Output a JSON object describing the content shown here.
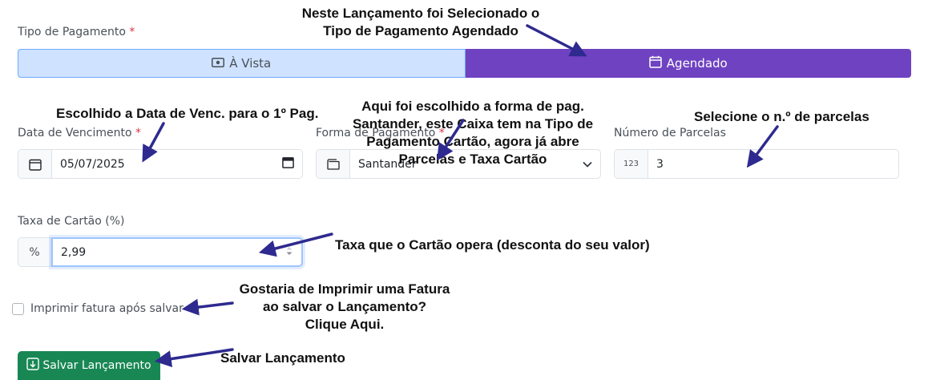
{
  "payment_type": {
    "label": "Tipo de Pagamento",
    "required_mark": "*",
    "options": [
      {
        "label": "À Vista",
        "icon": "cash-icon",
        "selected": false
      },
      {
        "label": "Agendado",
        "icon": "calendar-icon",
        "selected": true
      }
    ]
  },
  "due_date": {
    "label": "Data de Vencimento",
    "required_mark": "*",
    "value": "05/07/2025",
    "icon": "calendar-icon"
  },
  "payment_method": {
    "label": "Forma de Pagamento",
    "required_mark": "*",
    "value": "Santander",
    "icon": "wallet-icon"
  },
  "installments": {
    "label": "Número de Parcelas",
    "addon": "123",
    "value": "3"
  },
  "card_fee": {
    "label": "Taxa de Cartão (%)",
    "addon": "%",
    "value": "2,99"
  },
  "print_invoice": {
    "label": "Imprimir fatura após salvar",
    "checked": false
  },
  "save_button": {
    "label": "Salvar Lançamento",
    "icon": "download-icon"
  },
  "annotations": {
    "top_line1": "Neste Lançamento foi Selecionado o",
    "top_line2": "Tipo de Pagamento Agendado",
    "due_date": "Escolhido a Data de Venc. para o 1º Pag.",
    "method_line1": "Aqui foi escolhido a forma de pag.",
    "method_line2": "Santander, este Caixa tem na Tipo de",
    "method_line3": "Pagamento Cartão, agora já abre",
    "method_line4": "Parcelas e Taxa Cartão",
    "installments": "Selecione o n.º de parcelas",
    "fee": "Taxa que o Cartão opera (desconta do seu valor)",
    "print_line1": "Gostaria de Imprimir uma Fatura",
    "print_line2": "ao salvar o Lançamento?",
    "print_line3": "Clique Aqui.",
    "save": "Salvar Lançamento"
  },
  "colors": {
    "selected_option": "#6f42c1",
    "unselected_option": "#cfe2ff",
    "save_button": "#198754",
    "arrow": "#2e2a8f",
    "required": "#dc3545"
  }
}
